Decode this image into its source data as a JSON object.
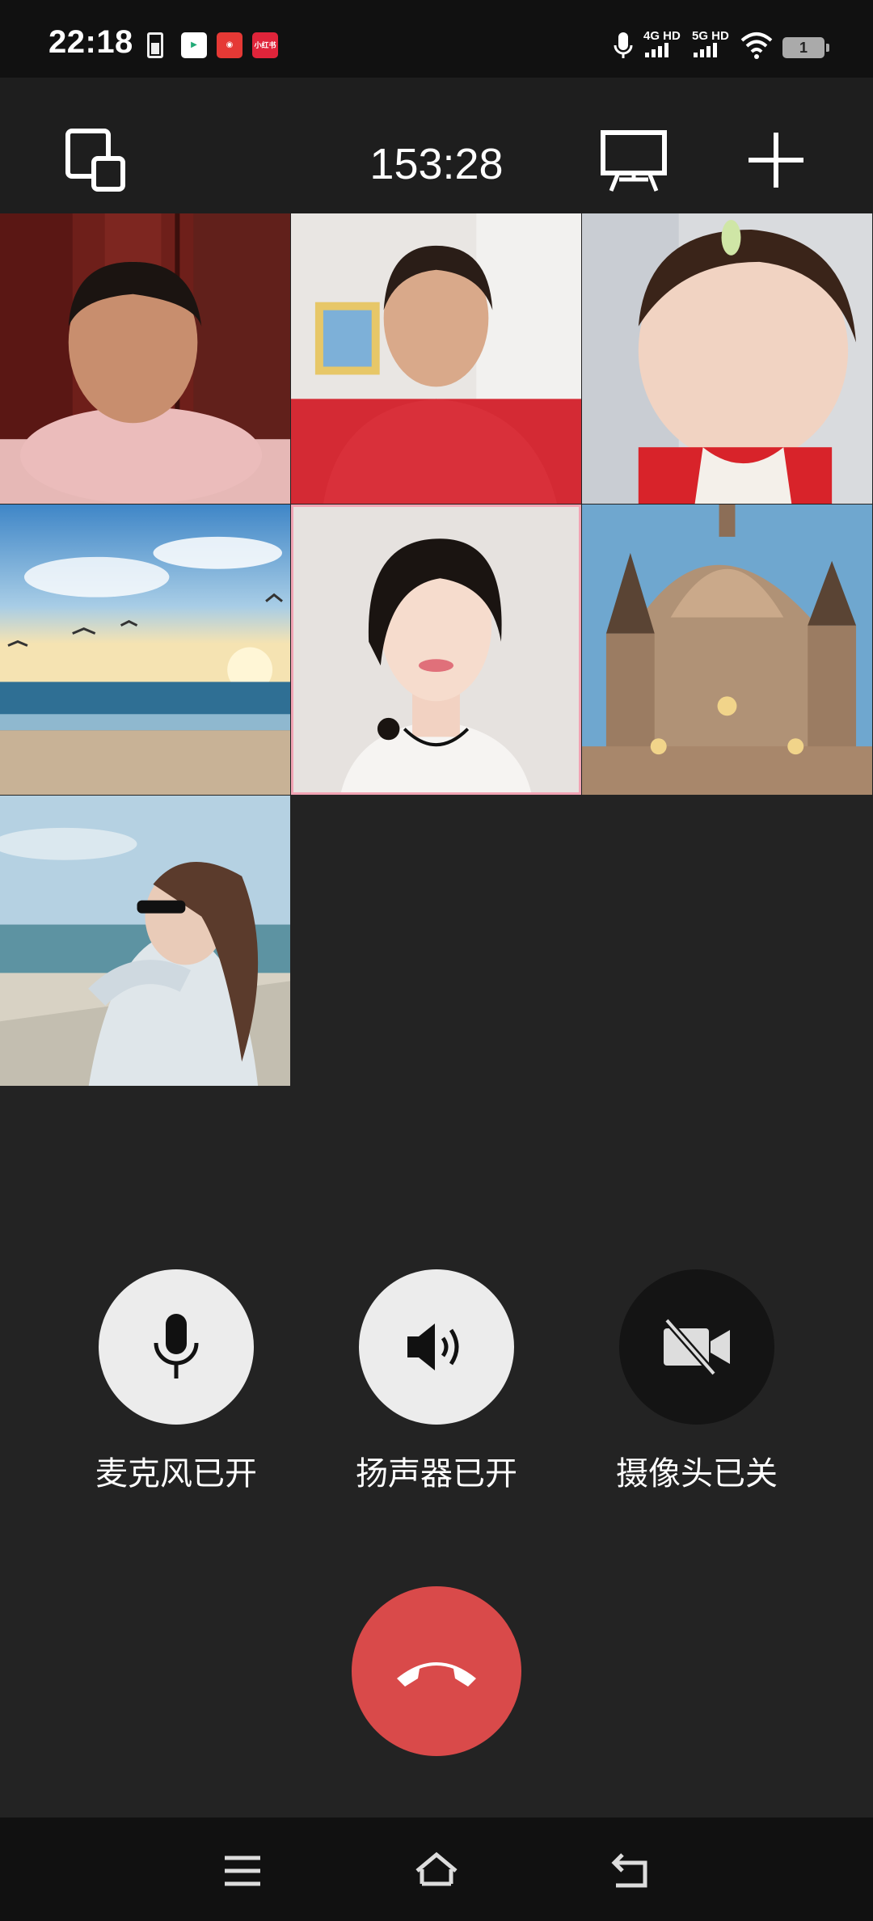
{
  "status_bar": {
    "time": "22:18",
    "network_1": "4G HD",
    "network_2": "5G HD",
    "battery_level": "1",
    "app_badges": [
      "",
      "",
      "小红书"
    ]
  },
  "call": {
    "duration": "153:28"
  },
  "controls": {
    "microphone_label": "麦克风已开",
    "speaker_label": "扬声器已开",
    "camera_label": "摄像头已关"
  },
  "participants_count": 7,
  "icons": {
    "switch_view": "switch-view-icon",
    "screen_share": "screen-share-icon",
    "add": "add-icon",
    "mic": "microphone-icon",
    "speaker": "speaker-icon",
    "camera_off": "camera-off-icon",
    "hangup": "hangup-icon"
  },
  "colors": {
    "hangup": "#d94a4a",
    "background": "#232323",
    "control_on": "#ececec",
    "control_off": "#141414"
  }
}
